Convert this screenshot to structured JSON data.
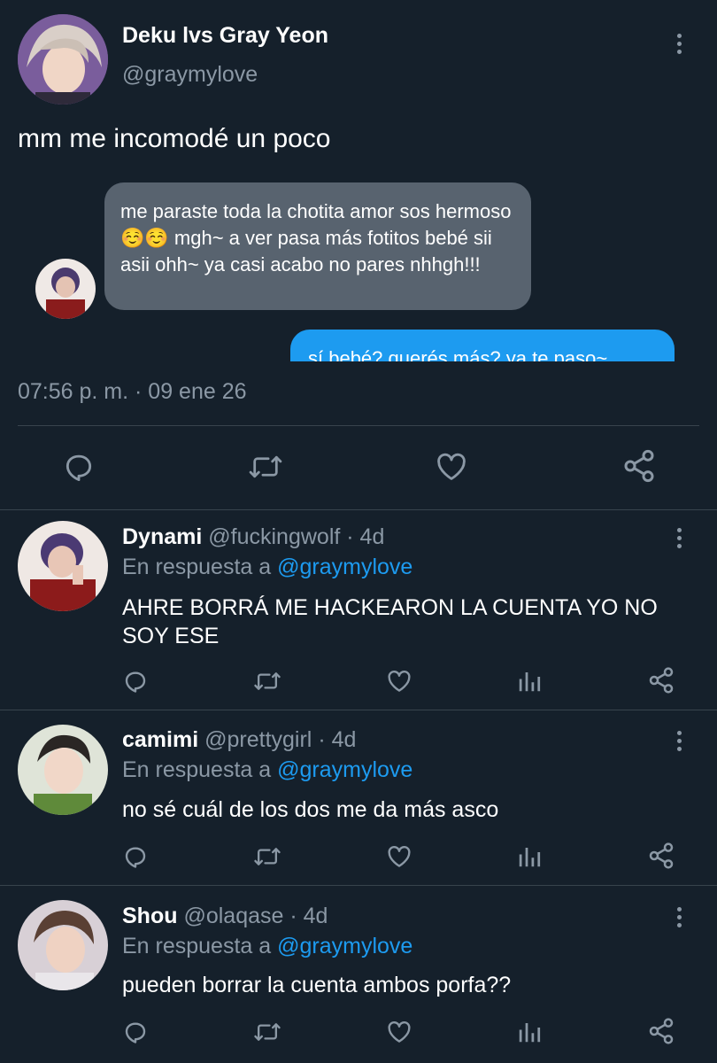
{
  "tweet": {
    "author_name": "Deku lvs Gray Yeon",
    "author_handle": "@graymylove",
    "text": "mm me incomodé un poco",
    "timestamp": "07:56 p. m. · 09 ene 26",
    "embedded_chat": {
      "received_message": "me paraste toda la chotita amor sos hermoso☺️☺️ mgh~ a ver pasa más fotitos bebé sii asii ohh~ ya casi acabo no pares nhhgh!!!",
      "sent_message_partial": "sí bebé? querés más? ya te paso~"
    }
  },
  "replies": [
    {
      "name": "Dynami",
      "handle": "@fuckingwolf",
      "time": "· 4d",
      "reply_prefix": "En respuesta a",
      "reply_to": "@graymylove",
      "text": "AHRE BORRÁ ME HACKEARON LA CUENTA YO NO SOY ESE"
    },
    {
      "name": "camimi",
      "handle": "@prettygirl",
      "time": "· 4d",
      "reply_prefix": "En respuesta a",
      "reply_to": "@graymylove",
      "text": "no sé cuál de los dos me da más asco"
    },
    {
      "name": "Shou",
      "handle": "@olaqase",
      "time": "· 4d",
      "reply_prefix": "En respuesta a",
      "reply_to": "@graymylove",
      "text": "pueden borrar la cuenta ambos porfa??"
    }
  ],
  "colors": {
    "background": "#15202b",
    "accent": "#1d9bf0",
    "secondary_text": "#8b98a5",
    "divider": "#38444d"
  },
  "icons": [
    "reply-icon",
    "retweet-icon",
    "like-icon",
    "share-icon",
    "analytics-icon",
    "more-icon"
  ]
}
